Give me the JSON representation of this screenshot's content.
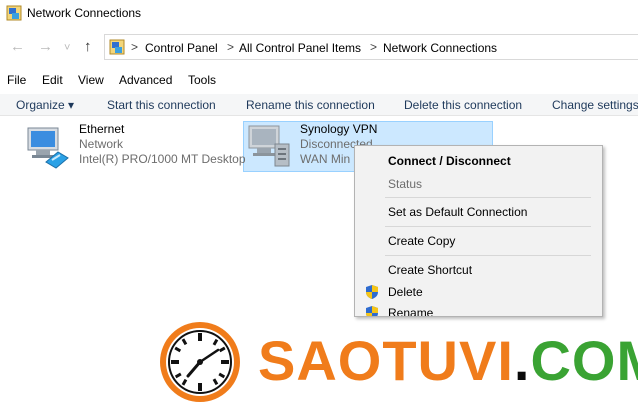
{
  "window": {
    "title": "Network Connections"
  },
  "nav": {
    "back": "←",
    "forward": "→",
    "recent": "˅",
    "up": "↑"
  },
  "breadcrumb": {
    "items": [
      "Control Panel",
      "All Control Panel Items",
      "Network Connections"
    ],
    "separator": ">"
  },
  "menubar": {
    "items": [
      "File",
      "Edit",
      "View",
      "Advanced",
      "Tools"
    ]
  },
  "commandbar": {
    "organize": "Organize ▾",
    "items": [
      "Start this connection",
      "Rename this connection",
      "Delete this connection",
      "Change settings"
    ]
  },
  "connections": [
    {
      "name": "Ethernet",
      "status": "Network",
      "device": "Intel(R) PRO/1000 MT Desktop",
      "icon": "network-adapter-icon"
    },
    {
      "name": "Synology VPN",
      "status": "Disconnected",
      "device": "WAN Min",
      "icon": "vpn-adapter-icon",
      "selected": true
    }
  ],
  "context_menu": {
    "items": [
      {
        "label": "Connect / Disconnect",
        "bold": true
      },
      {
        "label": "Status",
        "disabled": true
      },
      {
        "label": "Set as Default Connection"
      },
      {
        "label": "Create Copy"
      },
      {
        "label": "Create Shortcut"
      },
      {
        "label": "Delete",
        "shield": true
      },
      {
        "label": "Rename",
        "shield": true
      }
    ]
  },
  "watermark": {
    "part1": "SAOTUVI",
    "dot": ".",
    "part2": "COM"
  },
  "colors": {
    "selection": "#cce8ff",
    "command_text": "#1e395b",
    "watermark_orange": "#f07c1b",
    "watermark_green": "#3aa333"
  }
}
